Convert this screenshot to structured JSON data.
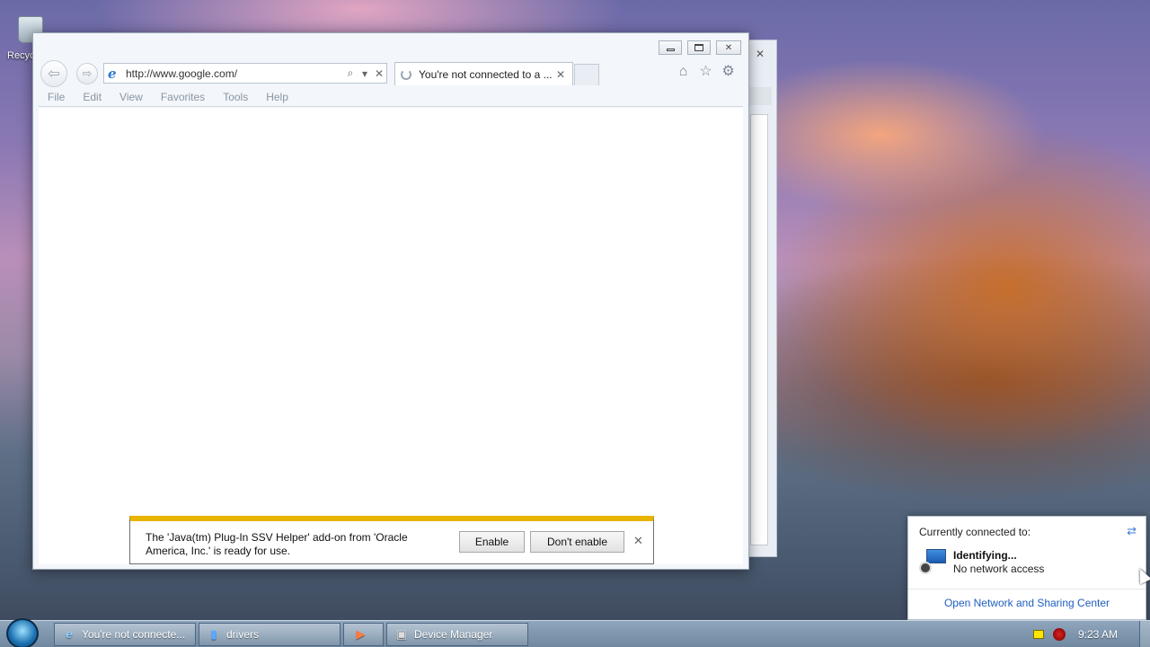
{
  "desktop": {
    "recycle_bin_label": "Recyc"
  },
  "browser": {
    "url": "http://www.google.com/",
    "tab_title": "You're not connected to a ...",
    "menu": [
      "File",
      "Edit",
      "View",
      "Favorites",
      "Tools",
      "Help"
    ],
    "notification": {
      "message": "The 'Java(tm) Plug-In SSV Helper' add-on from 'Oracle America, Inc.' is ready for use.",
      "enable_label": "Enable",
      "dont_enable_label": "Don't enable"
    }
  },
  "network_flyout": {
    "title": "Currently connected to:",
    "network_name": "Identifying...",
    "network_status": "No network access",
    "link": "Open Network and Sharing Center"
  },
  "taskbar": {
    "buttons": [
      {
        "label": "You're not connecte...",
        "icon": "ie-icon"
      },
      {
        "label": "drivers",
        "icon": "folder-icon"
      },
      {
        "label": "",
        "icon": "media-player-icon"
      },
      {
        "label": "Device Manager",
        "icon": "device-manager-icon"
      }
    ],
    "clock": "9:23 AM"
  },
  "colors": {
    "notification_accent": "#e8b400",
    "link": "#1f5fbf"
  }
}
